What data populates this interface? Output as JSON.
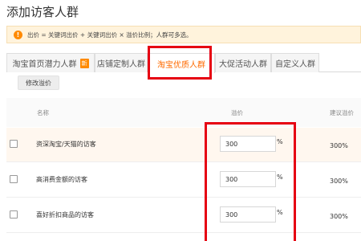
{
  "page": {
    "title": "添加访客人群"
  },
  "notice": {
    "icon": "exclamation-icon",
    "text": "出价 = 关键词出价 + 关键词出价 × 溢价比例；人群可多选。"
  },
  "tabs": [
    {
      "label": "淘宝首页潜力人群",
      "badge": "新"
    },
    {
      "label": "店铺定制人群"
    },
    {
      "label": "淘宝优质人群",
      "active": true
    },
    {
      "label": "大促活动人群"
    },
    {
      "label": "自定义人群"
    }
  ],
  "toolbar": {
    "edit_premium_label": "修改溢价"
  },
  "table": {
    "headers": {
      "name": "名称",
      "premium": "溢价",
      "suggested": "建议溢价"
    },
    "rows": [
      {
        "name": "资深淘宝/天猫的访客",
        "premium": "300",
        "unit": "%",
        "suggested": "300%"
      },
      {
        "name": "高消费金额的访客",
        "premium": "300",
        "unit": "%",
        "suggested": "300%"
      },
      {
        "name": "喜好折扣商品的访客",
        "premium": "300",
        "unit": "%",
        "suggested": "300%"
      }
    ]
  },
  "colors": {
    "accent": "#ff6a00",
    "highlight": "#e60012",
    "notice_bg": "#fff3dc"
  }
}
